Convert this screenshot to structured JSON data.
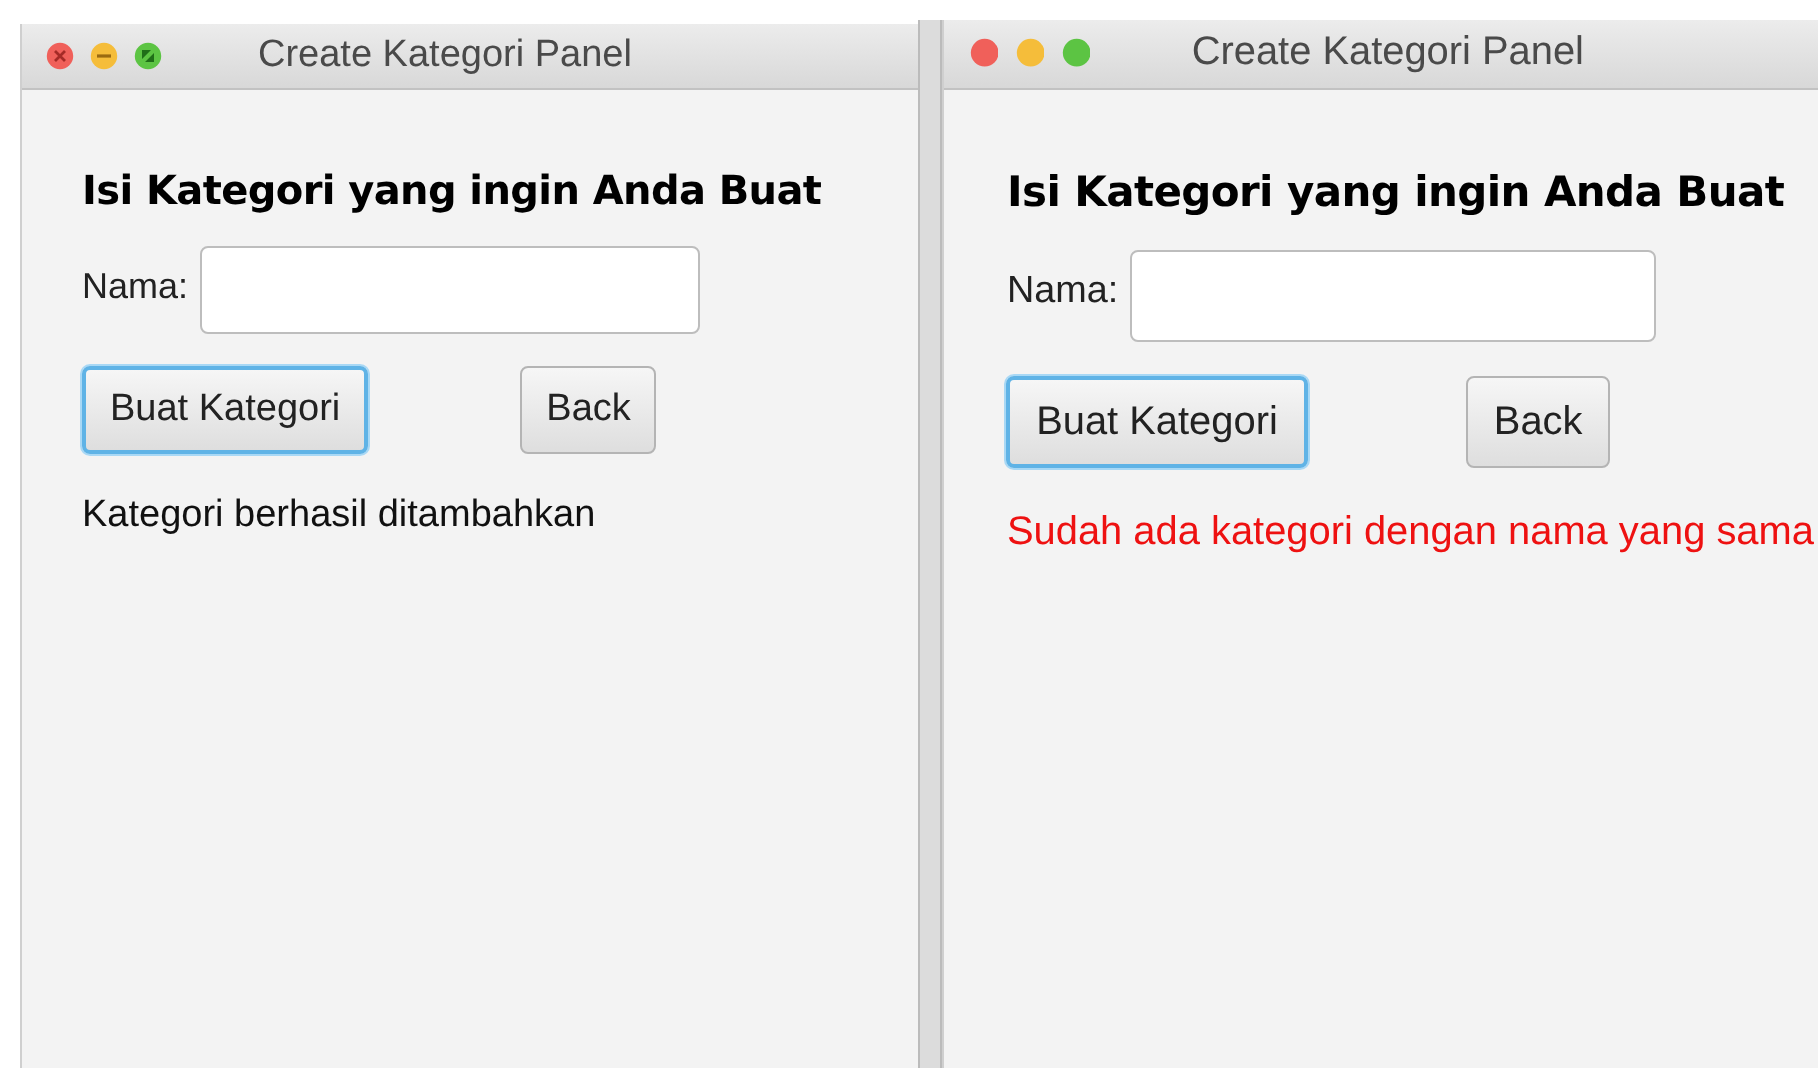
{
  "windows": [
    {
      "title": "Create Kategori Panel",
      "controls_hovered": true,
      "heading": "Isi Kategori yang ingin Anda Buat",
      "name_label": "Nama:",
      "buttons": [
        {
          "label": "Buat Kategori",
          "focused": true
        },
        {
          "label": "Back",
          "focused": false
        }
      ],
      "message": {
        "kind": "success",
        "text": "Kategori berhasil ditambahkan"
      }
    },
    {
      "title": "Create Kategori Panel",
      "controls_hovered": false,
      "heading": "Isi Kategori yang ingin Anda Buat",
      "name_label": "Nama:",
      "buttons": [
        {
          "label": "Buat Kategori",
          "focused": true
        },
        {
          "label": "Back",
          "focused": false
        }
      ],
      "message": {
        "kind": "error",
        "text": "Sudah ada kategori dengan nama yang sama"
      }
    }
  ]
}
